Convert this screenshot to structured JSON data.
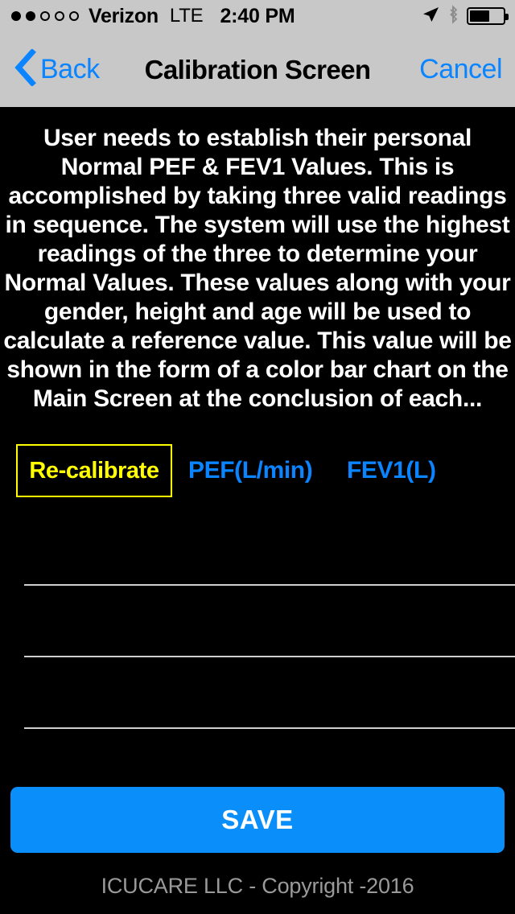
{
  "status_bar": {
    "carrier": "Verizon",
    "network": "LTE",
    "time": "2:40 PM",
    "signal_bars_filled": 2,
    "signal_bars_total": 5,
    "battery_percent": 55,
    "icons": [
      "location-arrow-icon",
      "bluetooth-icon",
      "battery-icon"
    ],
    "background_color": "#c8c8c8"
  },
  "nav_bar": {
    "back_label": "Back",
    "title": "Calibration Screen",
    "cancel_label": "Cancel",
    "accent_color": "#0a84ff",
    "background_color": "#c8c8c8"
  },
  "main": {
    "description": "User needs to establish their personal Normal PEF & FEV1 Values. This is accomplished by taking three valid readings in sequence. The system will use the highest readings of the three to determine your Normal Values. These values along with your gender, height and age will be used to calculate a reference value. This value will be shown in the form of a color bar chart on the Main Screen at the conclusion of each...",
    "recalibrate_label": "Re-calibrate",
    "recalibrate_color": "#ffff00",
    "units": [
      {
        "label": "PEF(L/min)",
        "color": "#0a84ff"
      },
      {
        "label": "FEV1(L)",
        "color": "#0a84ff"
      }
    ],
    "readings": [
      {
        "pef_value": "",
        "fev1_value": "",
        "placeholder": ""
      },
      {
        "pef_value": "",
        "fev1_value": "",
        "placeholder": ""
      },
      {
        "pef_value": "",
        "fev1_value": "",
        "placeholder": ""
      }
    ],
    "save_label": "SAVE",
    "save_color": "#0a8ffa",
    "background_color": "#000000"
  },
  "footer": {
    "copyright": "ICUCARE LLC - Copyright -2016",
    "color": "#9a9a9a"
  }
}
